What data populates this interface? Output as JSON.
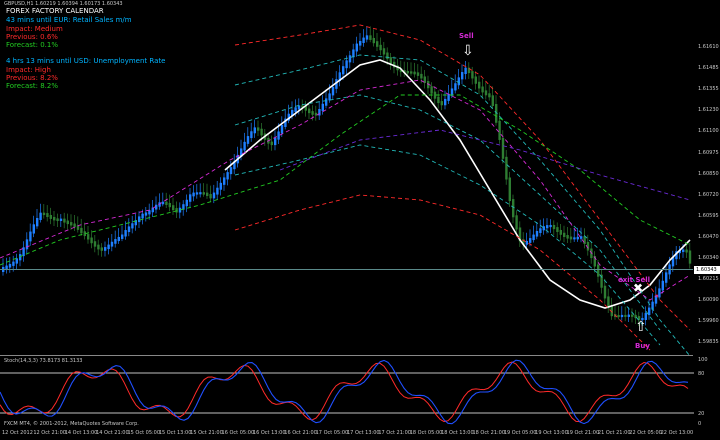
{
  "header": {
    "symbol_info": "GBPUSD,H1  1.60219 1.60394 1.60173 1.60343",
    "calendar_title": "FOREX FACTORY CALENDAR",
    "event1": {
      "title": "43 mins until EUR: Retail Sales m/m",
      "impact": "Impact: Medium",
      "previous": "Previous: 0.6%",
      "forecast": "Forecast: 0.1%"
    },
    "event2": {
      "title": "4 hrs 13 mins until USD: Unemployment Rate",
      "impact": "Impact: High",
      "previous": "Previous: 8.2%",
      "forecast": "Forecast: 8.2%"
    }
  },
  "annotations": {
    "sell_top": "Sell",
    "exit_sell": "exit Sell",
    "buy_bottom": "Buy"
  },
  "price_axis": {
    "labels": [
      "1.61610",
      "1.61485",
      "1.61355",
      "1.61230",
      "1.61100",
      "1.60975",
      "1.60850",
      "1.60720",
      "1.60595",
      "1.60470",
      "1.60340",
      "1.60215",
      "1.60090",
      "1.59960",
      "1.59835"
    ],
    "current_price": "1.60343"
  },
  "oscillator": {
    "title": "Stoch(14,3,3) 73.8173 81.3133",
    "levels": [
      "100",
      "80",
      "20",
      "0"
    ]
  },
  "x_axis": {
    "labels": [
      "12 Oct 2012",
      "12 Oct 21:00",
      "14 Oct 13:00",
      "14 Oct 21:00",
      "15 Oct 05:00",
      "15 Oct 13:00",
      "15 Oct 21:00",
      "16 Oct 05:00",
      "16 Oct 13:00",
      "16 Oct 21:00",
      "17 Oct 05:00",
      "17 Oct 13:00",
      "17 Oct 21:00",
      "18 Oct 05:00",
      "18 Oct 13:00",
      "18 Oct 21:00",
      "19 Oct 05:00",
      "19 Oct 13:00",
      "19 Oct 21:00",
      "21 Oct 21:00",
      "22 Oct 05:00",
      "22 Oct 13:00"
    ]
  },
  "copyright": "FXCM MT4, © 2001-2012, MetaQuotes Software Corp.",
  "colors": {
    "bull": "#1e7fff",
    "bear": "#2e7d32",
    "event_title": "#00b4ff",
    "impact": "#ff2a2a",
    "previous": "#ff2a2a",
    "forecast": "#22cc22",
    "arrow_label": "#d62ad6",
    "stoch_main": "#1f4fff",
    "stoch_signal": "#ff2a2a"
  }
}
